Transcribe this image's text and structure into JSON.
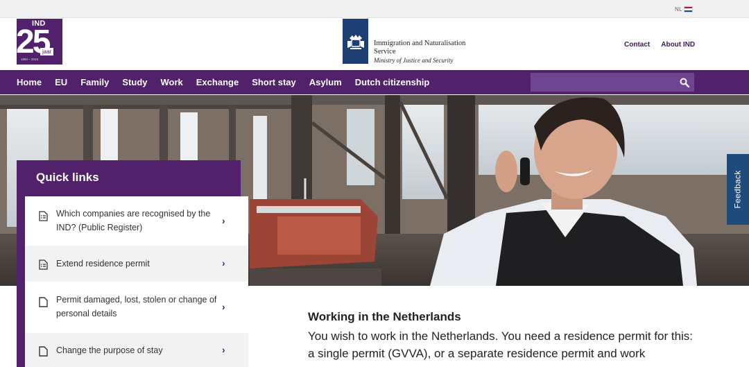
{
  "lang": {
    "label": "NL"
  },
  "logo": {
    "ind": "IND",
    "number": "25",
    "jaar": "jaar",
    "years": "1994 – 2019"
  },
  "ministry": {
    "name": "Immigration and Naturalisation Service",
    "sub": "Ministry of Justice and Security"
  },
  "top_links": [
    "Contact",
    "About IND"
  ],
  "nav": {
    "items": [
      "Home",
      "EU",
      "Family",
      "Study",
      "Work",
      "Exchange",
      "Short stay",
      "Asylum",
      "Dutch citizenship"
    ]
  },
  "search": {
    "placeholder": "",
    "icon": "search-icon"
  },
  "quick_links": {
    "title": "Quick links",
    "items": [
      {
        "label": "Which companies are recognised by the IND? (Public Register)",
        "icon": "document-list-icon"
      },
      {
        "label": "Extend residence permit",
        "icon": "document-list-icon"
      },
      {
        "label": "Permit damaged, lost, stolen or change of personal details",
        "icon": "document-icon"
      },
      {
        "label": "Change the purpose of stay",
        "icon": "document-icon"
      }
    ]
  },
  "feedback": {
    "label": "Feedback"
  },
  "content": {
    "title": "Working in the Netherlands",
    "text": "You wish to work in the Netherlands. You need a residence permit for this: a single permit (GVVA), or a separate residence permit and work"
  },
  "colors": {
    "brand": "#51216b",
    "brand_light": "#6e4590",
    "feedback": "#1f4a7c",
    "ministry": "#1d3f73"
  }
}
